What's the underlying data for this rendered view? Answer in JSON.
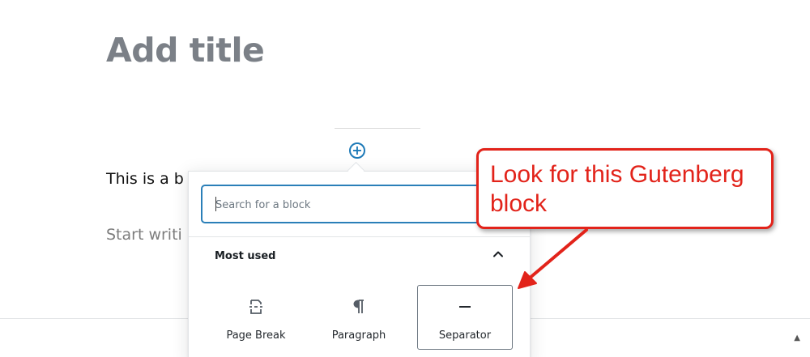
{
  "editor": {
    "title_placeholder": "Add title",
    "paragraph_text": "This is a b",
    "paragraph_placeholder": "Start writi",
    "inserter_symbol": "+"
  },
  "inserter": {
    "search": {
      "placeholder": "Search for a block",
      "value": ""
    },
    "section": {
      "title": "Most used",
      "expanded": true
    },
    "blocks": [
      {
        "label": "Page Break",
        "icon": "page-break-icon",
        "selected": false
      },
      {
        "label": "Paragraph",
        "icon": "pilcrow-icon",
        "selected": false
      },
      {
        "label": "Separator",
        "icon": "separator-icon",
        "selected": true
      }
    ]
  },
  "annotation": {
    "text": "Look for this Gutenberg block",
    "color": "#e2231a"
  },
  "colors": {
    "accent": "#1e7ab8",
    "title_gray": "#7b8087"
  },
  "bottom_bar": {
    "scroll_symbol": "▲"
  }
}
